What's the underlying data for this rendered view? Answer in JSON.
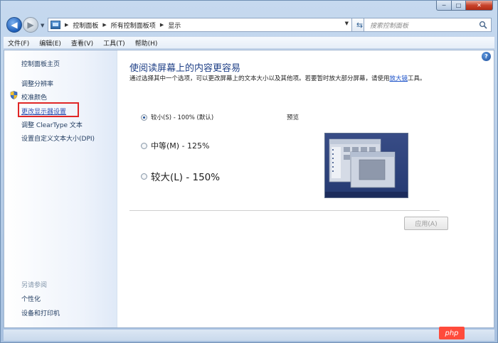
{
  "window": {
    "caption_min": "─",
    "caption_max": "□",
    "caption_close": "✕"
  },
  "address": {
    "breadcrumbs": [
      "控制面板",
      "所有控制面板项",
      "显示"
    ]
  },
  "search": {
    "placeholder": "搜索控制面板"
  },
  "menubar": {
    "items": [
      "文件(F)",
      "编辑(E)",
      "查看(V)",
      "工具(T)",
      "帮助(H)"
    ]
  },
  "sidebar": {
    "home": "控制面板主页",
    "items": [
      "调整分辨率",
      "校准颜色",
      "更改显示器设置",
      "调整 ClearType 文本",
      "设置自定义文本大小(DPI)"
    ],
    "see_also_title": "另请参阅",
    "see_also": [
      "个性化",
      "设备和打印机"
    ]
  },
  "main": {
    "title": "使阅读屏幕上的内容更容易",
    "description_before": "通过选择其中一个选项，可以更改屏幕上的文本大小以及其他项。若要暂时放大部分屏幕，请使用",
    "magnifier_link": "放大镜",
    "description_after": "工具。",
    "options": [
      {
        "label": "较小(S) - 100% (默认)",
        "checked": true
      },
      {
        "label": "中等(M) - 125%",
        "checked": false
      },
      {
        "label": "较大(L) - 150%",
        "checked": false
      }
    ],
    "preview_label": "预览",
    "apply_button": "应用(A)",
    "help_glyph": "?"
  },
  "watermark": {
    "text": "php"
  },
  "colors": {
    "title_blue": "#1e3f86",
    "link_blue": "#1b51c8",
    "highlight_red": "#e02626"
  }
}
